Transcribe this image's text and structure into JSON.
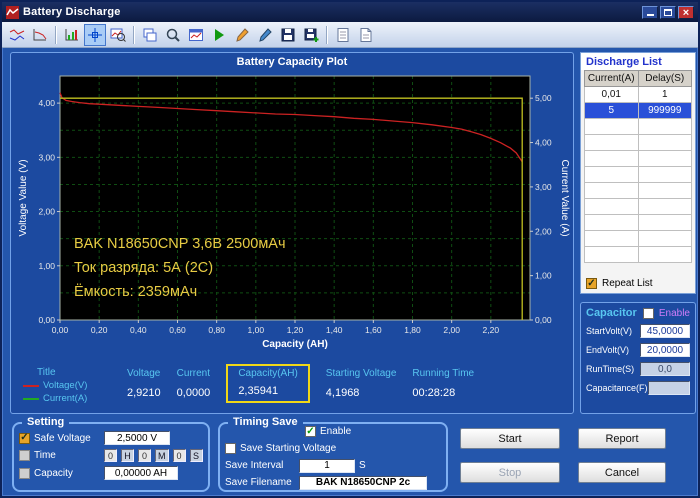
{
  "window": {
    "title": "Battery Discharge"
  },
  "toolbar": {
    "icons": [
      {
        "name": "curves-chart-icon"
      },
      {
        "name": "voltage-chart-icon"
      },
      {
        "name": "separator"
      },
      {
        "name": "grid-chart-icon"
      },
      {
        "name": "pan-crosshair-icon",
        "active": true
      },
      {
        "name": "zoom-chart-icon"
      },
      {
        "name": "separator"
      },
      {
        "name": "cascade-windows-icon"
      },
      {
        "name": "zoom-icon"
      },
      {
        "name": "window-chart-icon"
      },
      {
        "name": "start-test-icon"
      },
      {
        "name": "pencil-icon"
      },
      {
        "name": "marker-icon"
      },
      {
        "name": "save-icon"
      },
      {
        "name": "save-data-icon"
      },
      {
        "name": "separator"
      },
      {
        "name": "report-icon"
      },
      {
        "name": "log-icon"
      }
    ]
  },
  "chart_data": {
    "type": "line",
    "title": "Battery Capacity Plot",
    "xlabel": "Capacity (AH)",
    "ylabel_left": "Voltage Value (V)",
    "ylabel_right": "Current Value (A)",
    "xlim": [
      0,
      2.4
    ],
    "x_tick": 0.2,
    "ylim_left": [
      0,
      4.5
    ],
    "ylim_right": [
      0,
      5.5
    ],
    "grid_step": 0.5,
    "grid_color": "#0f4d12",
    "series": [
      {
        "name": "Voltage(V)",
        "axis": "left",
        "color": "#cc2222",
        "points": [
          [
            0,
            4.19
          ],
          [
            0.01,
            4.1
          ],
          [
            0.03,
            4.05
          ],
          [
            0.06,
            4.03
          ],
          [
            0.1,
            4.01
          ],
          [
            0.15,
            3.99
          ],
          [
            0.2,
            3.98
          ],
          [
            0.3,
            3.96
          ],
          [
            0.4,
            3.94
          ],
          [
            0.5,
            3.92
          ],
          [
            0.6,
            3.9
          ],
          [
            0.7,
            3.88
          ],
          [
            0.8,
            3.86
          ],
          [
            0.9,
            3.84
          ],
          [
            1.0,
            3.82
          ],
          [
            1.1,
            3.8
          ],
          [
            1.2,
            3.79
          ],
          [
            1.3,
            3.77
          ],
          [
            1.4,
            3.75
          ],
          [
            1.5,
            3.72
          ],
          [
            1.6,
            3.7
          ],
          [
            1.7,
            3.67
          ],
          [
            1.8,
            3.64
          ],
          [
            1.9,
            3.6
          ],
          [
            2.0,
            3.55
          ],
          [
            2.05,
            3.52
          ],
          [
            2.1,
            3.47
          ],
          [
            2.15,
            3.42
          ],
          [
            2.2,
            3.35
          ],
          [
            2.25,
            3.27
          ],
          [
            2.3,
            3.17
          ],
          [
            2.33,
            3.08
          ],
          [
            2.36,
            2.92
          ]
        ]
      },
      {
        "name": "Current(A)",
        "axis": "right",
        "color": "#c0c020",
        "points": [
          [
            0,
            5
          ],
          [
            2.36,
            5
          ],
          [
            2.36,
            0
          ]
        ]
      }
    ],
    "annotation": {
      "color": "#e8cc44",
      "lines": [
        "BAK N18650CNP 3,6В 2500мАч",
        "Ток разряда: 5А (2С)",
        "Ёмкость: 2359мАч"
      ]
    }
  },
  "status": {
    "title_label": "Title",
    "highlight_color": "#f0d818",
    "legend": [
      {
        "name": "Voltage(V)",
        "color": "#cc2222"
      },
      {
        "name": "Current(A)",
        "color": "#22aa22"
      }
    ],
    "columns": [
      {
        "label": "Voltage",
        "value": "2,9210"
      },
      {
        "label": "Current",
        "value": "0,0000"
      },
      {
        "label": "Capacity(AH)",
        "value": "2,35941",
        "highlighted": true
      },
      {
        "label": "Starting Voltage",
        "value": "4,1968"
      },
      {
        "label": "Running Time",
        "value": "00:28:28"
      }
    ]
  },
  "discharge_list": {
    "title": "Discharge List",
    "headers": [
      "Current(A)",
      "Delay(S)"
    ],
    "rows": [
      [
        "0,01",
        "1"
      ],
      [
        "5",
        "999999"
      ]
    ],
    "selected_row": 1,
    "repeat_label": "Repeat List",
    "repeat_checked": true
  },
  "capacitor": {
    "title": "Capacitor",
    "enable_label": "Enable",
    "enable_checked": false,
    "fields": [
      {
        "label": "StartVolt(V)",
        "value": "45,0000",
        "disabled": false
      },
      {
        "label": "EndVolt(V)",
        "value": "20,0000",
        "disabled": false
      },
      {
        "label": "RunTime(S)",
        "value": "0,0",
        "disabled": true
      },
      {
        "label": "Capacitance(F)",
        "value": "",
        "disabled": true
      }
    ]
  },
  "setting": {
    "title": "Setting",
    "safe_voltage": {
      "label": "Safe Voltage",
      "value": "2,5000 V",
      "checked": true
    },
    "time": {
      "label": "Time",
      "checked": false,
      "h": "0",
      "h_label": "H",
      "m": "0",
      "m_label": "M",
      "s": "0",
      "s_label": "S"
    },
    "capacity": {
      "label": "Capacity",
      "value": "0,00000 AH",
      "checked": false
    }
  },
  "timing_save": {
    "title": "Timing Save",
    "enable_label": "Enable",
    "enable_checked": true,
    "save_starting_voltage_label": "Save Starting Voltage",
    "save_starting_voltage_checked": false,
    "save_interval_label": "Save Interval",
    "save_interval_value": "1",
    "save_interval_unit": "S",
    "save_filename_label": "Save Filename",
    "save_filename_value": "BAK N18650CNP 2c"
  },
  "actions": {
    "start": "Start",
    "report": "Report",
    "stop": "Stop",
    "cancel": "Cancel"
  }
}
